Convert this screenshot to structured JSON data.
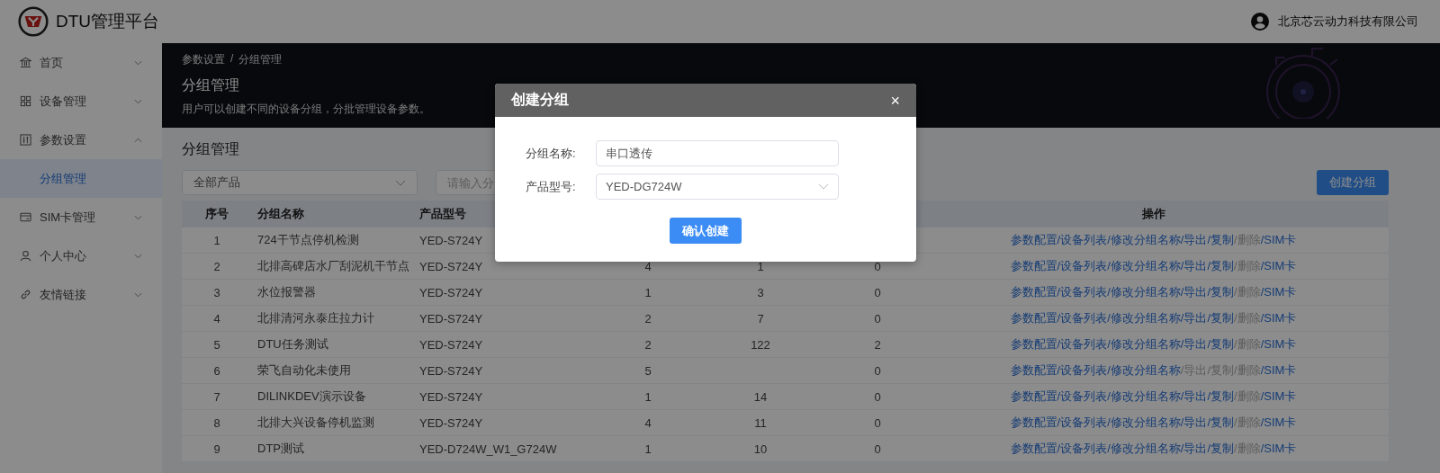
{
  "header": {
    "title": "DTU管理平台",
    "company": "北京芯云动力科技有限公司"
  },
  "sidebar": {
    "items": [
      {
        "label": "首页",
        "expanded": false
      },
      {
        "label": "设备管理",
        "expanded": false
      },
      {
        "label": "参数设置",
        "expanded": true,
        "children": [
          {
            "label": "分组管理",
            "selected": true
          }
        ]
      },
      {
        "label": "SIM卡管理",
        "expanded": false
      },
      {
        "label": "个人中心",
        "expanded": false
      },
      {
        "label": "友情链接",
        "expanded": false
      }
    ]
  },
  "banner": {
    "breadcrumb": [
      "参数设置",
      "/",
      "分组管理"
    ],
    "title": "分组管理",
    "description": "用户可以创建不同的设备分组，分批管理设备参数。"
  },
  "content": {
    "title": "分组管理",
    "product_filter": {
      "value": "全部产品"
    },
    "search": {
      "placeholder": "请输入分"
    },
    "create_button": "创建分组"
  },
  "table": {
    "columns": [
      "序号",
      "分组名称",
      "产品型号",
      "操作"
    ],
    "rows": [
      {
        "index": "1",
        "name": "724干节点停机检测",
        "model": "YED-S724Y",
        "actions": [
          {
            "label": "参数配置",
            "disabled": false
          },
          {
            "label": "/设备列表",
            "disabled": false
          },
          {
            "label": "/修改分组名称",
            "disabled": false
          },
          {
            "label": "/导出",
            "disabled": false
          },
          {
            "label": "/复制",
            "disabled": false
          },
          {
            "label": "/删除",
            "disabled": true
          },
          {
            "label": "/SIM卡",
            "disabled": false
          }
        ]
      },
      {
        "index": "2",
        "name": "北排高碑店水厂刮泥机干节点",
        "model": "YED-S724Y",
        "column_4": "4",
        "column_5": "1",
        "column_6": "0",
        "actions": [
          {
            "label": "参数配置",
            "disabled": false
          },
          {
            "label": "/设备列表",
            "disabled": false
          },
          {
            "label": "/修改分组名称",
            "disabled": false
          },
          {
            "label": "/导出",
            "disabled": false
          },
          {
            "label": "/复制",
            "disabled": false
          },
          {
            "label": "/删除",
            "disabled": true
          },
          {
            "label": "/SIM卡",
            "disabled": false
          }
        ]
      },
      {
        "index": "3",
        "name": "水位报警器",
        "model": "YED-S724Y",
        "column_4": "1",
        "column_5": "3",
        "column_6": "0",
        "actions": [
          {
            "label": "参数配置",
            "disabled": false
          },
          {
            "label": "/设备列表",
            "disabled": false
          },
          {
            "label": "/修改分组名称",
            "disabled": false
          },
          {
            "label": "/导出",
            "disabled": false
          },
          {
            "label": "/复制",
            "disabled": false
          },
          {
            "label": "/删除",
            "disabled": true
          },
          {
            "label": "/SIM卡",
            "disabled": false
          }
        ]
      },
      {
        "index": "4",
        "name": "北排清河永泰庄拉力计",
        "model": "YED-S724Y",
        "column_4": "2",
        "column_5": "7",
        "column_6": "0",
        "actions": [
          {
            "label": "参数配置",
            "disabled": false
          },
          {
            "label": "/设备列表",
            "disabled": false
          },
          {
            "label": "/修改分组名称",
            "disabled": false
          },
          {
            "label": "/导出",
            "disabled": false
          },
          {
            "label": "/复制",
            "disabled": false
          },
          {
            "label": "/删除",
            "disabled": true
          },
          {
            "label": "/SIM卡",
            "disabled": false
          }
        ]
      },
      {
        "index": "5",
        "name": "DTU任务测试",
        "model": "YED-S724Y",
        "column_4": "2",
        "column_5": "122",
        "column_6": "2",
        "actions": [
          {
            "label": "参数配置",
            "disabled": false
          },
          {
            "label": "/设备列表",
            "disabled": false
          },
          {
            "label": "/修改分组名称",
            "disabled": false
          },
          {
            "label": "/导出",
            "disabled": false
          },
          {
            "label": "/复制",
            "disabled": false
          },
          {
            "label": "/删除",
            "disabled": true
          },
          {
            "label": "/SIM卡",
            "disabled": false
          }
        ]
      },
      {
        "index": "6",
        "name": "荣飞自动化未使用",
        "model": "YED-S724Y",
        "column_4": "5",
        "column_6": "0",
        "actions": [
          {
            "label": "参数配置",
            "disabled": false
          },
          {
            "label": "/设备列表",
            "disabled": false
          },
          {
            "label": "/修改分组名称",
            "disabled": false
          },
          {
            "label": "/导出",
            "disabled": true
          },
          {
            "label": "/复制",
            "disabled": true
          },
          {
            "label": "/删除",
            "disabled": true
          },
          {
            "label": "/SIM卡",
            "disabled": false
          }
        ]
      },
      {
        "index": "7",
        "name": "DILINKDEV演示设备",
        "model": "YED-S724Y",
        "column_4": "1",
        "column_5": "14",
        "column_6": "0",
        "actions": [
          {
            "label": "参数配置",
            "disabled": false
          },
          {
            "label": "/设备列表",
            "disabled": false
          },
          {
            "label": "/修改分组名称",
            "disabled": false
          },
          {
            "label": "/导出",
            "disabled": false
          },
          {
            "label": "/复制",
            "disabled": false
          },
          {
            "label": "/删除",
            "disabled": true
          },
          {
            "label": "/SIM卡",
            "disabled": false
          }
        ]
      },
      {
        "index": "8",
        "name": "北排大兴设备停机监测",
        "model": "YED-S724Y",
        "column_4": "4",
        "column_5": "11",
        "column_6": "0",
        "actions": [
          {
            "label": "参数配置",
            "disabled": false
          },
          {
            "label": "/设备列表",
            "disabled": false
          },
          {
            "label": "/修改分组名称",
            "disabled": false
          },
          {
            "label": "/导出",
            "disabled": false
          },
          {
            "label": "/复制",
            "disabled": false
          },
          {
            "label": "/删除",
            "disabled": true
          },
          {
            "label": "/SIM卡",
            "disabled": false
          }
        ]
      },
      {
        "index": "9",
        "name": "DTP测试",
        "model": "YED-D724W_W1_G724W",
        "column_4": "1",
        "column_5": "10",
        "column_6": "0",
        "actions": [
          {
            "label": "参数配置",
            "disabled": false
          },
          {
            "label": "/设备列表",
            "disabled": false
          },
          {
            "label": "/修改分组名称",
            "disabled": false
          },
          {
            "label": "/导出",
            "disabled": false
          },
          {
            "label": "/复制",
            "disabled": false
          },
          {
            "label": "/删除",
            "disabled": true
          },
          {
            "label": "/SIM卡",
            "disabled": false
          }
        ]
      }
    ]
  },
  "dialog": {
    "title": "创建分组",
    "close": "×",
    "fields": [
      {
        "kind": "input",
        "label": "分组名称:",
        "value": "串口透传"
      },
      {
        "kind": "select",
        "label": "产品型号:",
        "value": "YED-DG724W"
      }
    ],
    "confirm_button": "确认创建"
  }
}
